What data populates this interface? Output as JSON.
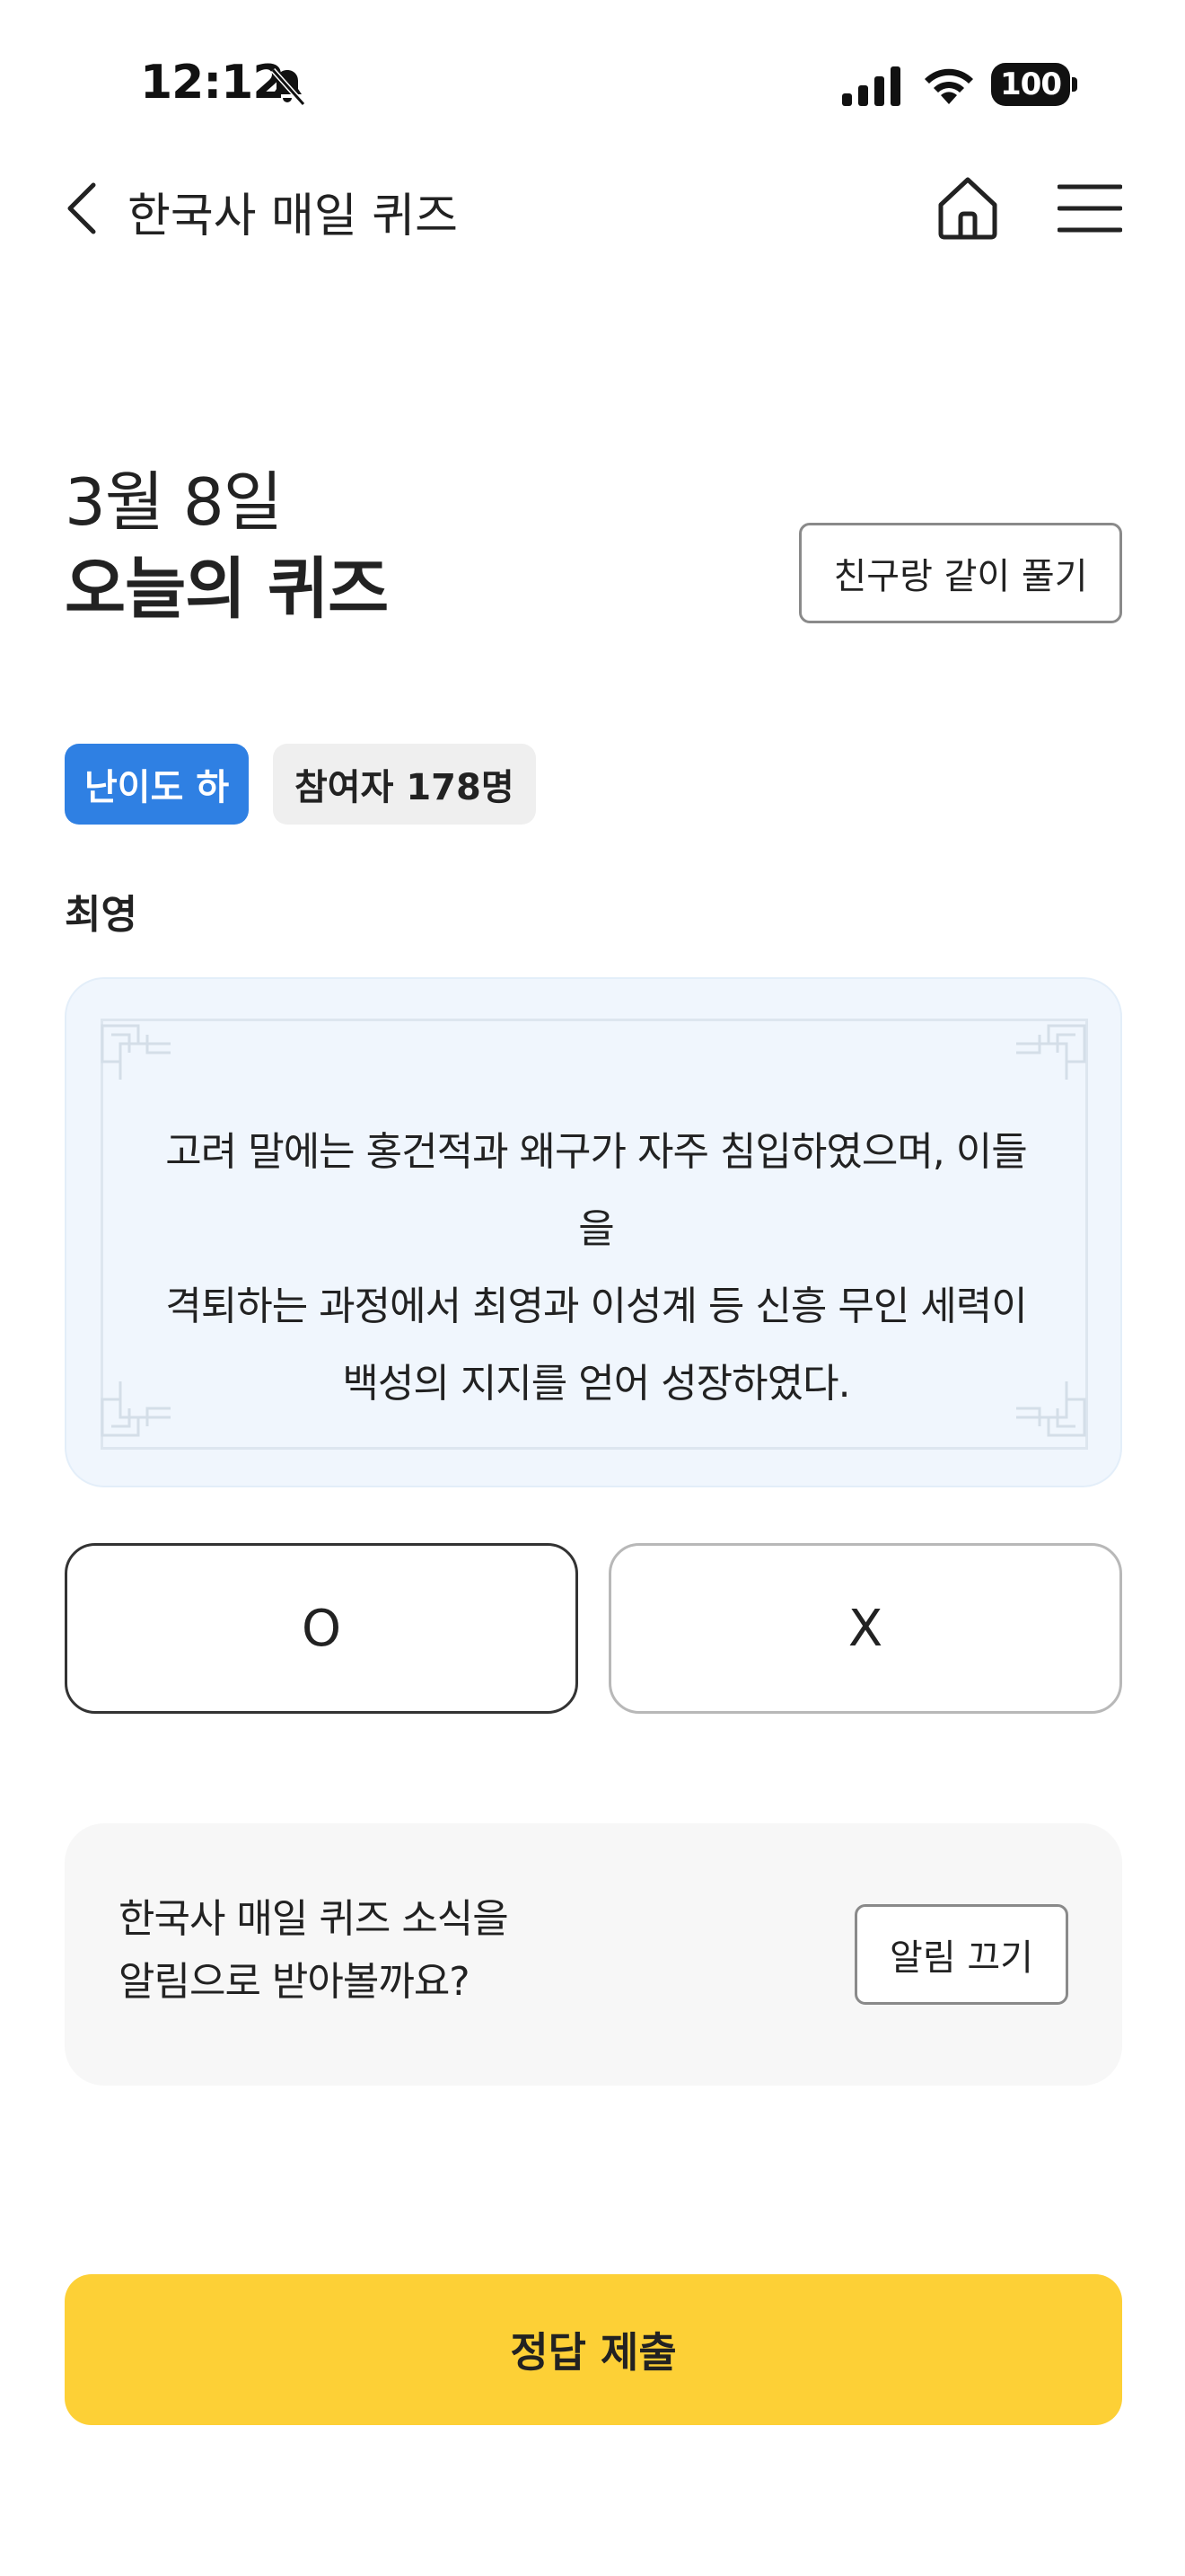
{
  "status_bar": {
    "time": "12:12",
    "battery": "100",
    "icons": [
      "bell-off-icon",
      "signal-icon",
      "wifi-icon",
      "battery-icon"
    ]
  },
  "header": {
    "title": "한국사 매일 퀴즈",
    "icons": [
      "back-icon",
      "home-icon",
      "menu-icon"
    ]
  },
  "quiz": {
    "date": "3월 8일",
    "title": "오늘의 퀴즈",
    "friend_button": "친구랑 같이 풀기",
    "difficulty_badge": "난이도 하",
    "participants_badge": "참여자 178명",
    "topic": "최영",
    "question_lines": [
      "고려 말에는 홍건적과 왜구가 자주 침입하였으며, 이들을",
      "격퇴하는 과정에서 최영과 이성계 등 신흥 무인 세력이",
      "백성의 지지를 얻어 성장하였다."
    ],
    "options": [
      "O",
      "X"
    ],
    "selected_option": "O"
  },
  "notification": {
    "line1": "한국사 매일 퀴즈 소식을",
    "line2": "알림으로 받아볼까요?",
    "button": "알림 끄기"
  },
  "submit": {
    "label": "정답 제출"
  },
  "colors": {
    "accent_blue": "#2f80e3",
    "submit_yellow": "#fdd036",
    "card_bg": "#f0f6fd",
    "notify_bg": "#f7f7f7"
  }
}
